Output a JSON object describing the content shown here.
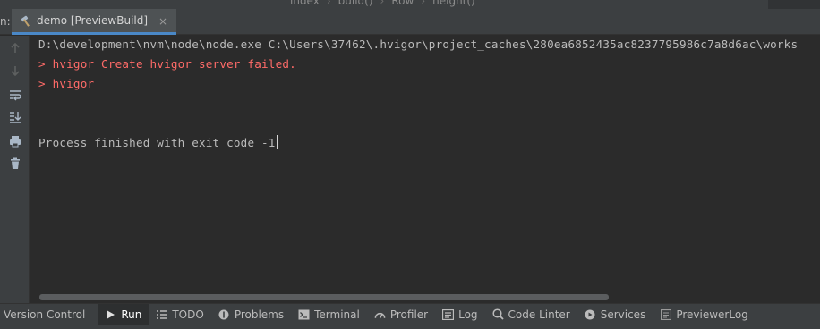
{
  "breadcrumb": [
    "index",
    "build()",
    "Row",
    "height()"
  ],
  "tab_header": {
    "panel_label": "n:",
    "run_tab_title": "demo [PreviewBuild]",
    "close_glyph": "×"
  },
  "console": {
    "command_line": "D:\\development\\nvm\\node\\node.exe C:\\Users\\37462\\.hvigor\\project_caches\\280ea6852435ac8237795986c7a8d6ac\\works",
    "error_lines": [
      "> hvigor Create hvigor server failed.",
      "> hvigor"
    ],
    "finish_line": "Process finished with exit code -1"
  },
  "tool_window_bar": [
    {
      "label": "Version Control",
      "icon": "none-icon",
      "active": false
    },
    {
      "label": "Run",
      "icon": "run-icon",
      "active": true
    },
    {
      "label": "TODO",
      "icon": "todo-icon",
      "active": false
    },
    {
      "label": "Problems",
      "icon": "problems-icon",
      "active": false
    },
    {
      "label": "Terminal",
      "icon": "terminal-icon",
      "active": false
    },
    {
      "label": "Profiler",
      "icon": "profiler-icon",
      "active": false
    },
    {
      "label": "Log",
      "icon": "log-icon",
      "active": false
    },
    {
      "label": "Code Linter",
      "icon": "code-linter-icon",
      "active": false
    },
    {
      "label": "Services",
      "icon": "services-icon",
      "active": false
    },
    {
      "label": "PreviewerLog",
      "icon": "previewer-log-icon",
      "active": false
    }
  ],
  "colors": {
    "accent_blue": "#4a88c7",
    "error_red": "#ff6b68",
    "console_text": "#bbbbbb"
  }
}
